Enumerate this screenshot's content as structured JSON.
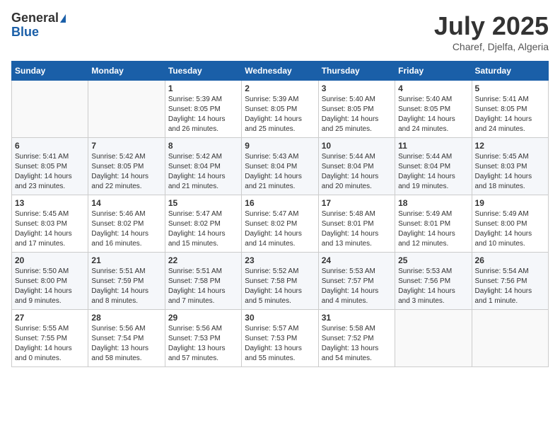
{
  "header": {
    "logo_general": "General",
    "logo_blue": "Blue",
    "month_title": "July 2025",
    "location": "Charef, Djelfa, Algeria"
  },
  "days_of_week": [
    "Sunday",
    "Monday",
    "Tuesday",
    "Wednesday",
    "Thursday",
    "Friday",
    "Saturday"
  ],
  "weeks": [
    [
      {
        "day": "",
        "content": ""
      },
      {
        "day": "",
        "content": ""
      },
      {
        "day": "1",
        "content": "Sunrise: 5:39 AM\nSunset: 8:05 PM\nDaylight: 14 hours and 26 minutes."
      },
      {
        "day": "2",
        "content": "Sunrise: 5:39 AM\nSunset: 8:05 PM\nDaylight: 14 hours and 25 minutes."
      },
      {
        "day": "3",
        "content": "Sunrise: 5:40 AM\nSunset: 8:05 PM\nDaylight: 14 hours and 25 minutes."
      },
      {
        "day": "4",
        "content": "Sunrise: 5:40 AM\nSunset: 8:05 PM\nDaylight: 14 hours and 24 minutes."
      },
      {
        "day": "5",
        "content": "Sunrise: 5:41 AM\nSunset: 8:05 PM\nDaylight: 14 hours and 24 minutes."
      }
    ],
    [
      {
        "day": "6",
        "content": "Sunrise: 5:41 AM\nSunset: 8:05 PM\nDaylight: 14 hours and 23 minutes."
      },
      {
        "day": "7",
        "content": "Sunrise: 5:42 AM\nSunset: 8:05 PM\nDaylight: 14 hours and 22 minutes."
      },
      {
        "day": "8",
        "content": "Sunrise: 5:42 AM\nSunset: 8:04 PM\nDaylight: 14 hours and 21 minutes."
      },
      {
        "day": "9",
        "content": "Sunrise: 5:43 AM\nSunset: 8:04 PM\nDaylight: 14 hours and 21 minutes."
      },
      {
        "day": "10",
        "content": "Sunrise: 5:44 AM\nSunset: 8:04 PM\nDaylight: 14 hours and 20 minutes."
      },
      {
        "day": "11",
        "content": "Sunrise: 5:44 AM\nSunset: 8:04 PM\nDaylight: 14 hours and 19 minutes."
      },
      {
        "day": "12",
        "content": "Sunrise: 5:45 AM\nSunset: 8:03 PM\nDaylight: 14 hours and 18 minutes."
      }
    ],
    [
      {
        "day": "13",
        "content": "Sunrise: 5:45 AM\nSunset: 8:03 PM\nDaylight: 14 hours and 17 minutes."
      },
      {
        "day": "14",
        "content": "Sunrise: 5:46 AM\nSunset: 8:02 PM\nDaylight: 14 hours and 16 minutes."
      },
      {
        "day": "15",
        "content": "Sunrise: 5:47 AM\nSunset: 8:02 PM\nDaylight: 14 hours and 15 minutes."
      },
      {
        "day": "16",
        "content": "Sunrise: 5:47 AM\nSunset: 8:02 PM\nDaylight: 14 hours and 14 minutes."
      },
      {
        "day": "17",
        "content": "Sunrise: 5:48 AM\nSunset: 8:01 PM\nDaylight: 14 hours and 13 minutes."
      },
      {
        "day": "18",
        "content": "Sunrise: 5:49 AM\nSunset: 8:01 PM\nDaylight: 14 hours and 12 minutes."
      },
      {
        "day": "19",
        "content": "Sunrise: 5:49 AM\nSunset: 8:00 PM\nDaylight: 14 hours and 10 minutes."
      }
    ],
    [
      {
        "day": "20",
        "content": "Sunrise: 5:50 AM\nSunset: 8:00 PM\nDaylight: 14 hours and 9 minutes."
      },
      {
        "day": "21",
        "content": "Sunrise: 5:51 AM\nSunset: 7:59 PM\nDaylight: 14 hours and 8 minutes."
      },
      {
        "day": "22",
        "content": "Sunrise: 5:51 AM\nSunset: 7:58 PM\nDaylight: 14 hours and 7 minutes."
      },
      {
        "day": "23",
        "content": "Sunrise: 5:52 AM\nSunset: 7:58 PM\nDaylight: 14 hours and 5 minutes."
      },
      {
        "day": "24",
        "content": "Sunrise: 5:53 AM\nSunset: 7:57 PM\nDaylight: 14 hours and 4 minutes."
      },
      {
        "day": "25",
        "content": "Sunrise: 5:53 AM\nSunset: 7:56 PM\nDaylight: 14 hours and 3 minutes."
      },
      {
        "day": "26",
        "content": "Sunrise: 5:54 AM\nSunset: 7:56 PM\nDaylight: 14 hours and 1 minute."
      }
    ],
    [
      {
        "day": "27",
        "content": "Sunrise: 5:55 AM\nSunset: 7:55 PM\nDaylight: 14 hours and 0 minutes."
      },
      {
        "day": "28",
        "content": "Sunrise: 5:56 AM\nSunset: 7:54 PM\nDaylight: 13 hours and 58 minutes."
      },
      {
        "day": "29",
        "content": "Sunrise: 5:56 AM\nSunset: 7:53 PM\nDaylight: 13 hours and 57 minutes."
      },
      {
        "day": "30",
        "content": "Sunrise: 5:57 AM\nSunset: 7:53 PM\nDaylight: 13 hours and 55 minutes."
      },
      {
        "day": "31",
        "content": "Sunrise: 5:58 AM\nSunset: 7:52 PM\nDaylight: 13 hours and 54 minutes."
      },
      {
        "day": "",
        "content": ""
      },
      {
        "day": "",
        "content": ""
      }
    ]
  ]
}
